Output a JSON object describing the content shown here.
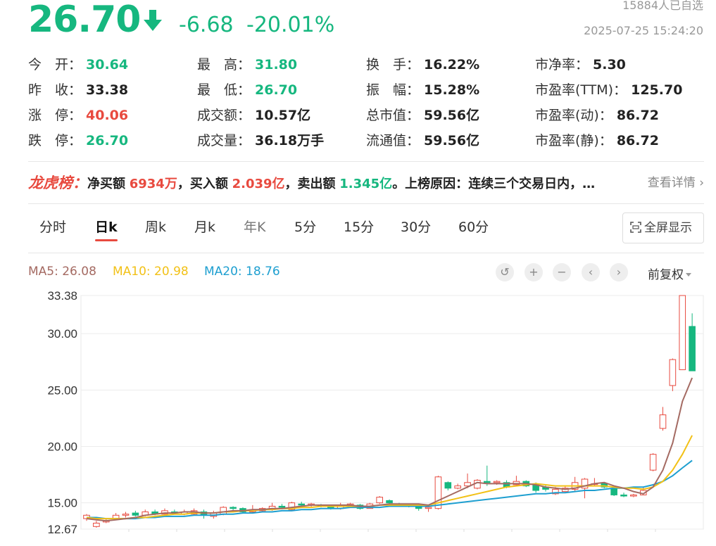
{
  "header": {
    "price": "26.70",
    "change": "-6.68",
    "change_pct": "-20.01%",
    "followers": "15884人已自选",
    "datetime": "2025-07-25 15:24:20",
    "arrow_icon": "arrow-down-icon"
  },
  "colors": {
    "down": "#16b77f",
    "up": "#e84a3f",
    "ma5": "#a46a62",
    "ma10": "#f2c117",
    "ma20": "#1e9fd0"
  },
  "stats": {
    "open": {
      "label": "今　开：",
      "value": "30.64"
    },
    "prev_close": {
      "label": "昨　收：",
      "value": "33.38"
    },
    "limit_up": {
      "label": "涨　停：",
      "value": "40.06"
    },
    "limit_down": {
      "label": "跌　停：",
      "value": "26.70"
    },
    "high": {
      "label": "最　高：",
      "value": "31.80"
    },
    "low": {
      "label": "最　低：",
      "value": "26.70"
    },
    "turnover_amount": {
      "label": "成交额：",
      "value": "10.57亿"
    },
    "volume": {
      "label": "成交量：",
      "value": "36.18万手"
    },
    "turnover_rate": {
      "label": "换　手：",
      "value": "16.22%"
    },
    "amplitude": {
      "label": "振　幅：",
      "value": "15.28%"
    },
    "total_mv": {
      "label": "总市值：",
      "value": "59.56亿"
    },
    "float_mv": {
      "label": "流通值：",
      "value": "59.56亿"
    },
    "pb": {
      "label": "市净率：",
      "value": "5.30"
    },
    "pe_ttm": {
      "label": "市盈率(TTM)：",
      "value": "125.70"
    },
    "pe_dyn": {
      "label": "市盈率(动)：",
      "value": "86.72"
    },
    "pe_static": {
      "label": "市盈率(静)：",
      "value": "86.72"
    }
  },
  "lhb": {
    "title": "龙虎榜：",
    "net_buy_label": "净买额",
    "net_buy": "6934万",
    "sep1": "，",
    "buy_label": "买入额",
    "buy": "2.039亿",
    "sep2": "，",
    "sell_label": "卖出额",
    "sell": "1.345亿",
    "reason_label": "。上榜原因：",
    "reason": "连续三个交易日内，…",
    "detail": "查看详情 ›"
  },
  "tabs": [
    "分时",
    "日k",
    "周k",
    "月k",
    "年K",
    "5分",
    "15分",
    "30分",
    "60分"
  ],
  "active_tab": "日k",
  "fullscreen_label": "全屏显示",
  "ma_legend": {
    "ma5": "MA5: 26.08",
    "ma10": "MA10: 20.98",
    "ma20": "MA20: 18.76"
  },
  "controls": {
    "reset": "↺",
    "zoom_in": "+",
    "zoom_out": "−",
    "prev": "‹",
    "next": "›"
  },
  "adjust_label": "前复权",
  "chart_data": {
    "type": "candlestick",
    "y_ticks": [
      "33.38",
      "30.00",
      "25.00",
      "20.00",
      "15.00",
      "12.67"
    ],
    "ylim": [
      12.67,
      33.38
    ],
    "grid": true,
    "candles": [
      {
        "o": 13.6,
        "c": 13.9,
        "h": 14.0,
        "l": 13.4
      },
      {
        "o": 12.9,
        "c": 13.2,
        "h": 13.4,
        "l": 12.8
      },
      {
        "o": 13.3,
        "c": 13.4,
        "h": 13.6,
        "l": 13.2
      },
      {
        "o": 13.6,
        "c": 13.9,
        "h": 14.1,
        "l": 13.5
      },
      {
        "o": 13.9,
        "c": 14.0,
        "h": 14.2,
        "l": 13.7
      },
      {
        "o": 14.1,
        "c": 13.9,
        "h": 14.3,
        "l": 13.8
      },
      {
        "o": 13.9,
        "c": 14.2,
        "h": 14.4,
        "l": 13.8
      },
      {
        "o": 14.2,
        "c": 14.0,
        "h": 14.4,
        "l": 13.9
      },
      {
        "o": 14.0,
        "c": 14.3,
        "h": 14.5,
        "l": 13.9
      },
      {
        "o": 14.2,
        "c": 14.1,
        "h": 14.4,
        "l": 14.0
      },
      {
        "o": 14.0,
        "c": 14.2,
        "h": 14.4,
        "l": 13.9
      },
      {
        "o": 14.0,
        "c": 14.3,
        "h": 14.5,
        "l": 13.9
      },
      {
        "o": 14.2,
        "c": 13.9,
        "h": 14.4,
        "l": 13.6
      },
      {
        "o": 13.8,
        "c": 14.1,
        "h": 14.3,
        "l": 13.6
      },
      {
        "o": 14.0,
        "c": 14.6,
        "h": 14.7,
        "l": 13.9
      },
      {
        "o": 14.6,
        "c": 14.5,
        "h": 14.7,
        "l": 14.3
      },
      {
        "o": 14.5,
        "c": 14.2,
        "h": 14.6,
        "l": 14.1
      },
      {
        "o": 14.2,
        "c": 14.4,
        "h": 14.8,
        "l": 14.1
      },
      {
        "o": 14.3,
        "c": 14.5,
        "h": 14.6,
        "l": 14.2
      },
      {
        "o": 14.4,
        "c": 14.7,
        "h": 15.0,
        "l": 14.3
      },
      {
        "o": 14.7,
        "c": 14.6,
        "h": 14.9,
        "l": 14.5
      },
      {
        "o": 14.4,
        "c": 15.0,
        "h": 15.1,
        "l": 14.3
      },
      {
        "o": 14.9,
        "c": 14.8,
        "h": 15.1,
        "l": 14.7
      },
      {
        "o": 14.8,
        "c": 14.9,
        "h": 15.0,
        "l": 14.6
      },
      {
        "o": 14.8,
        "c": 14.7,
        "h": 14.9,
        "l": 14.6
      },
      {
        "o": 14.7,
        "c": 14.5,
        "h": 14.8,
        "l": 14.4
      },
      {
        "o": 14.5,
        "c": 14.8,
        "h": 15.0,
        "l": 14.4
      },
      {
        "o": 14.8,
        "c": 14.9,
        "h": 15.0,
        "l": 14.7
      },
      {
        "o": 14.8,
        "c": 14.5,
        "h": 14.9,
        "l": 14.4
      },
      {
        "o": 14.5,
        "c": 14.9,
        "h": 15.0,
        "l": 14.5
      },
      {
        "o": 15.0,
        "c": 15.5,
        "h": 15.6,
        "l": 14.9
      },
      {
        "o": 15.2,
        "c": 15.0,
        "h": 15.3,
        "l": 14.8
      },
      {
        "o": 14.9,
        "c": 14.8,
        "h": 15.0,
        "l": 14.7
      },
      {
        "o": 14.8,
        "c": 14.7,
        "h": 14.9,
        "l": 14.6
      },
      {
        "o": 14.7,
        "c": 14.5,
        "h": 14.8,
        "l": 14.3
      },
      {
        "o": 14.5,
        "c": 14.6,
        "h": 14.8,
        "l": 14.2
      },
      {
        "o": 14.5,
        "c": 17.3,
        "h": 17.4,
        "l": 14.4
      },
      {
        "o": 16.8,
        "c": 16.3,
        "h": 16.9,
        "l": 16.1
      },
      {
        "o": 16.3,
        "c": 16.5,
        "h": 16.7,
        "l": 16.2
      },
      {
        "o": 16.5,
        "c": 16.8,
        "h": 17.6,
        "l": 16.3
      },
      {
        "o": 16.3,
        "c": 17.0,
        "h": 17.1,
        "l": 16.2
      },
      {
        "o": 16.9,
        "c": 16.8,
        "h": 18.3,
        "l": 16.5
      },
      {
        "o": 16.8,
        "c": 16.9,
        "h": 17.0,
        "l": 16.6
      },
      {
        "o": 16.8,
        "c": 16.4,
        "h": 17.0,
        "l": 16.3
      },
      {
        "o": 16.6,
        "c": 16.9,
        "h": 17.4,
        "l": 16.5
      },
      {
        "o": 16.9,
        "c": 16.5,
        "h": 17.0,
        "l": 16.4
      },
      {
        "o": 16.6,
        "c": 16.1,
        "h": 16.8,
        "l": 15.9
      },
      {
        "o": 16.4,
        "c": 16.2,
        "h": 16.6,
        "l": 16.0
      },
      {
        "o": 15.8,
        "c": 16.2,
        "h": 16.4,
        "l": 15.7
      },
      {
        "o": 16.0,
        "c": 16.3,
        "h": 16.5,
        "l": 15.9
      },
      {
        "o": 16.2,
        "c": 16.8,
        "h": 17.3,
        "l": 16.0
      },
      {
        "o": 16.3,
        "c": 17.1,
        "h": 17.2,
        "l": 15.4
      },
      {
        "o": 16.7,
        "c": 16.7,
        "h": 17.2,
        "l": 16.5
      },
      {
        "o": 16.7,
        "c": 16.4,
        "h": 16.8,
        "l": 16.3
      },
      {
        "o": 16.3,
        "c": 15.7,
        "h": 16.4,
        "l": 15.6
      },
      {
        "o": 15.7,
        "c": 15.6,
        "h": 15.9,
        "l": 15.5
      },
      {
        "o": 15.6,
        "c": 15.7,
        "h": 15.8,
        "l": 15.5
      },
      {
        "o": 15.7,
        "c": 16.1,
        "h": 16.4,
        "l": 15.7
      },
      {
        "o": 17.9,
        "c": 19.3,
        "h": 19.4,
        "l": 17.8
      },
      {
        "o": 21.6,
        "c": 22.8,
        "h": 23.5,
        "l": 21.4
      },
      {
        "o": 25.4,
        "c": 27.7,
        "h": 27.8,
        "l": 24.9
      },
      {
        "o": 26.8,
        "c": 33.38,
        "h": 33.38,
        "l": 26.8
      },
      {
        "o": 30.64,
        "c": 26.7,
        "h": 31.8,
        "l": 26.7
      }
    ],
    "ma5": [
      13.6,
      13.5,
      13.4,
      13.5,
      13.6,
      13.7,
      13.9,
      14.0,
      14.1,
      14.1,
      14.2,
      14.2,
      14.1,
      14.1,
      14.2,
      14.3,
      14.3,
      14.4,
      14.4,
      14.5,
      14.5,
      14.6,
      14.7,
      14.8,
      14.8,
      14.8,
      14.8,
      14.8,
      14.7,
      14.7,
      14.8,
      14.9,
      14.9,
      14.9,
      14.9,
      14.8,
      15.2,
      15.6,
      16.0,
      16.4,
      16.8,
      16.7,
      16.7,
      16.7,
      16.7,
      16.7,
      16.6,
      16.4,
      16.3,
      16.2,
      16.3,
      16.5,
      16.7,
      16.8,
      16.5,
      16.3,
      16.0,
      15.8,
      16.4,
      17.9,
      20.3,
      24.0,
      26.08
    ],
    "ma10": [
      13.7,
      13.6,
      13.6,
      13.6,
      13.6,
      13.7,
      13.7,
      13.8,
      13.9,
      14.0,
      14.0,
      14.1,
      14.1,
      14.1,
      14.2,
      14.2,
      14.3,
      14.3,
      14.4,
      14.4,
      14.5,
      14.5,
      14.6,
      14.6,
      14.7,
      14.7,
      14.7,
      14.7,
      14.7,
      14.7,
      14.8,
      14.8,
      14.8,
      14.8,
      14.8,
      14.8,
      15.0,
      15.2,
      15.4,
      15.6,
      15.8,
      16.0,
      16.2,
      16.4,
      16.5,
      16.6,
      16.7,
      16.6,
      16.5,
      16.5,
      16.5,
      16.5,
      16.5,
      16.5,
      16.4,
      16.3,
      16.3,
      16.2,
      16.4,
      16.9,
      17.9,
      19.3,
      20.98
    ],
    "ma20": [
      13.7,
      13.7,
      13.6,
      13.6,
      13.6,
      13.6,
      13.7,
      13.7,
      13.8,
      13.8,
      13.8,
      13.9,
      13.9,
      13.9,
      14.0,
      14.0,
      14.1,
      14.1,
      14.2,
      14.2,
      14.3,
      14.3,
      14.4,
      14.4,
      14.5,
      14.5,
      14.5,
      14.6,
      14.6,
      14.6,
      14.6,
      14.7,
      14.7,
      14.7,
      14.7,
      14.7,
      14.8,
      14.9,
      15.0,
      15.1,
      15.2,
      15.3,
      15.4,
      15.5,
      15.6,
      15.7,
      15.8,
      15.8,
      15.9,
      15.9,
      16.0,
      16.1,
      16.1,
      16.2,
      16.3,
      16.3,
      16.4,
      16.4,
      16.6,
      16.9,
      17.4,
      18.1,
      18.76
    ]
  }
}
